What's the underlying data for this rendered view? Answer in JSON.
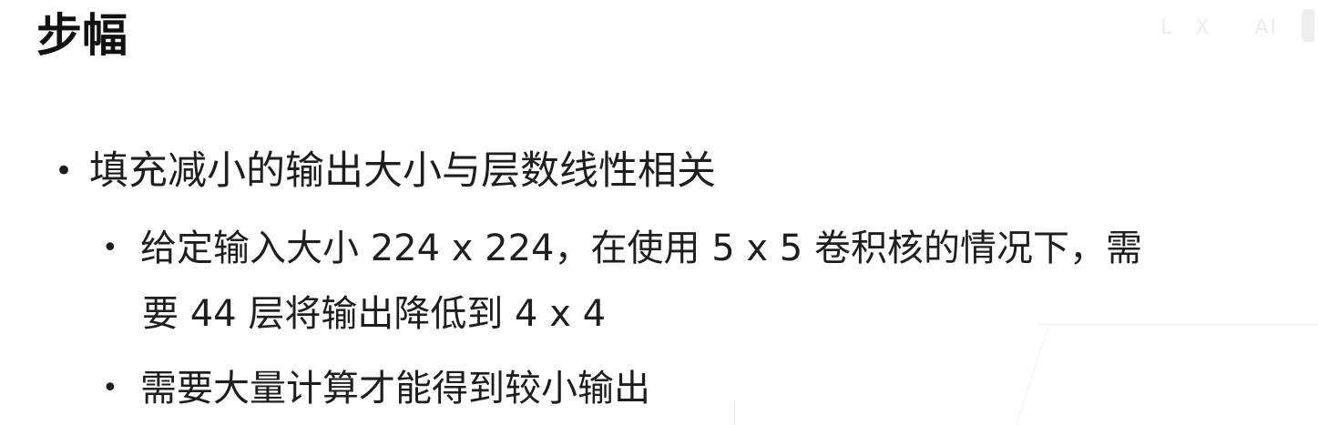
{
  "slide": {
    "title": "步幅",
    "watermark": "L　X　　AI"
  },
  "bullets": {
    "level1": {
      "marker": "•",
      "text": "填充减小的输出大小与层数线性相关"
    },
    "sub": [
      {
        "marker": "•",
        "line1": " 给定输入大小 224 x 224，在使用 5 x 5 卷积核的情况下，需",
        "line2": "要 44 层将输出降低到 4 x 4"
      },
      {
        "marker": "•",
        "line1": "需要大量计算才能得到较小输出"
      }
    ]
  }
}
